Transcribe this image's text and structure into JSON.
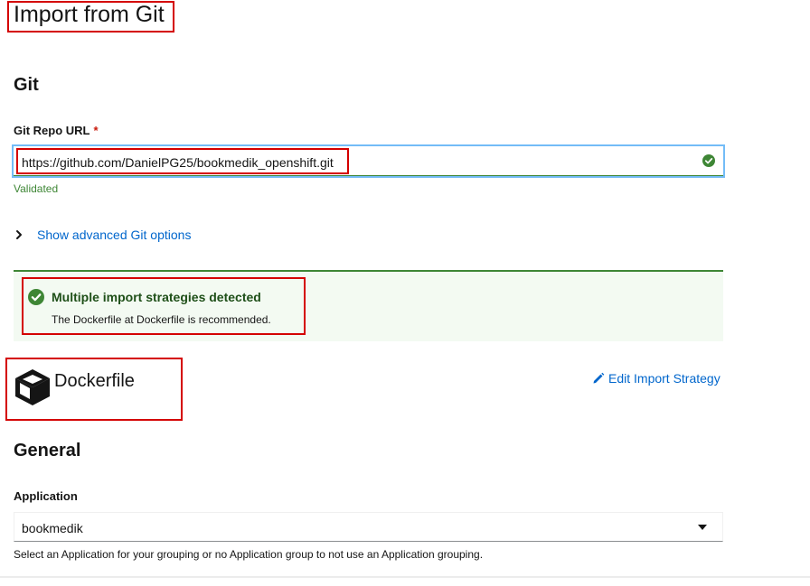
{
  "page": {
    "title": "Import from Git"
  },
  "git_section": {
    "heading": "Git",
    "repo_url_label": "Git Repo URL",
    "required_marker": "*",
    "repo_url_value": "https://github.com/DanielPG25/bookmedik_openshift.git",
    "validation_text": "Validated",
    "advanced_toggle": "Show advanced Git options"
  },
  "alert": {
    "title": "Multiple import strategies detected",
    "description": "The Dockerfile at Dockerfile is recommended."
  },
  "strategy": {
    "name": "Dockerfile",
    "edit_link": "Edit Import Strategy"
  },
  "general_section": {
    "heading": "General",
    "application_label": "Application",
    "application_value": "bookmedik",
    "helper_text": "Select an Application for your grouping or no Application group to not use an Application grouping."
  },
  "colors": {
    "success": "#3e8635",
    "link": "#0066cc",
    "highlight": "#d40000",
    "required": "#c9190b"
  },
  "icons": {
    "url_status": "check-circle-icon",
    "advanced": "chevron-right-icon",
    "alert": "check-circle-icon",
    "strategy": "cube-icon",
    "edit": "pencil-icon",
    "select": "caret-down-icon"
  }
}
